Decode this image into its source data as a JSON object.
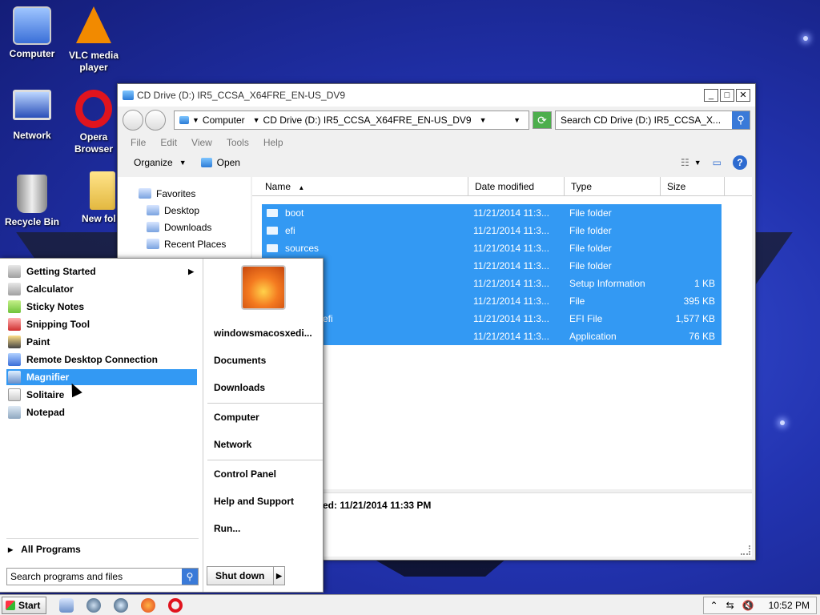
{
  "desktop": {
    "icons": [
      {
        "label": "Computer"
      },
      {
        "label": "VLC media player"
      },
      {
        "label": "Network"
      },
      {
        "label": "Opera Browser"
      },
      {
        "label": "Recycle Bin"
      },
      {
        "label": "New fol"
      }
    ]
  },
  "explorer": {
    "title": "CD Drive (D:) IR5_CCSA_X64FRE_EN-US_DV9",
    "address": {
      "crumb1": "Computer",
      "crumb2": "CD Drive (D:) IR5_CCSA_X64FRE_EN-US_DV9"
    },
    "search_placeholder": "Search CD Drive (D:) IR5_CCSA_X...",
    "menu": [
      "File",
      "Edit",
      "View",
      "Tools",
      "Help"
    ],
    "toolbar": {
      "organize": "Organize",
      "open": "Open"
    },
    "nav": {
      "favorites": "Favorites",
      "items": [
        "Desktop",
        "Downloads",
        "Recent Places"
      ]
    },
    "columns": {
      "name": "Name",
      "date": "Date modified",
      "type": "Type",
      "size": "Size"
    },
    "files": [
      {
        "name": "boot",
        "date": "11/21/2014 11:3...",
        "type": "File folder",
        "size": ""
      },
      {
        "name": "efi",
        "date": "11/21/2014 11:3...",
        "type": "File folder",
        "size": ""
      },
      {
        "name": "sources",
        "date": "11/21/2014 11:3...",
        "type": "File folder",
        "size": ""
      },
      {
        "name": "",
        "date": "11/21/2014 11:3...",
        "type": "File folder",
        "size": ""
      },
      {
        "name": "",
        "date": "11/21/2014 11:3...",
        "type": "Setup Information",
        "size": "1 KB"
      },
      {
        "name": "",
        "date": "11/21/2014 11:3...",
        "type": "File",
        "size": "395 KB"
      },
      {
        "name": "efi",
        "date": "11/21/2014 11:3...",
        "type": "EFI File",
        "size": "1,577 KB"
      },
      {
        "name": "",
        "date": "11/21/2014 11:3...",
        "type": "Application",
        "size": "76 KB"
      }
    ],
    "details_text": "ed: 11/21/2014 11:33 PM"
  },
  "startmenu": {
    "programs": [
      {
        "label": "Getting Started",
        "has_sub": true
      },
      {
        "label": "Calculator"
      },
      {
        "label": "Sticky Notes"
      },
      {
        "label": "Snipping Tool"
      },
      {
        "label": "Paint"
      },
      {
        "label": "Remote Desktop Connection"
      },
      {
        "label": "Magnifier",
        "selected": true
      },
      {
        "label": "Solitaire"
      },
      {
        "label": "Notepad"
      }
    ],
    "all_programs": "All Programs",
    "search_placeholder": "Search programs and files",
    "user": "windowsmacosxedi...",
    "places": [
      "Documents",
      "Downloads",
      "Computer",
      "Network",
      "Control Panel",
      "Help and Support",
      "Run..."
    ],
    "shutdown": "Shut down"
  },
  "taskbar": {
    "start": "Start",
    "clock": "10:52 PM"
  }
}
